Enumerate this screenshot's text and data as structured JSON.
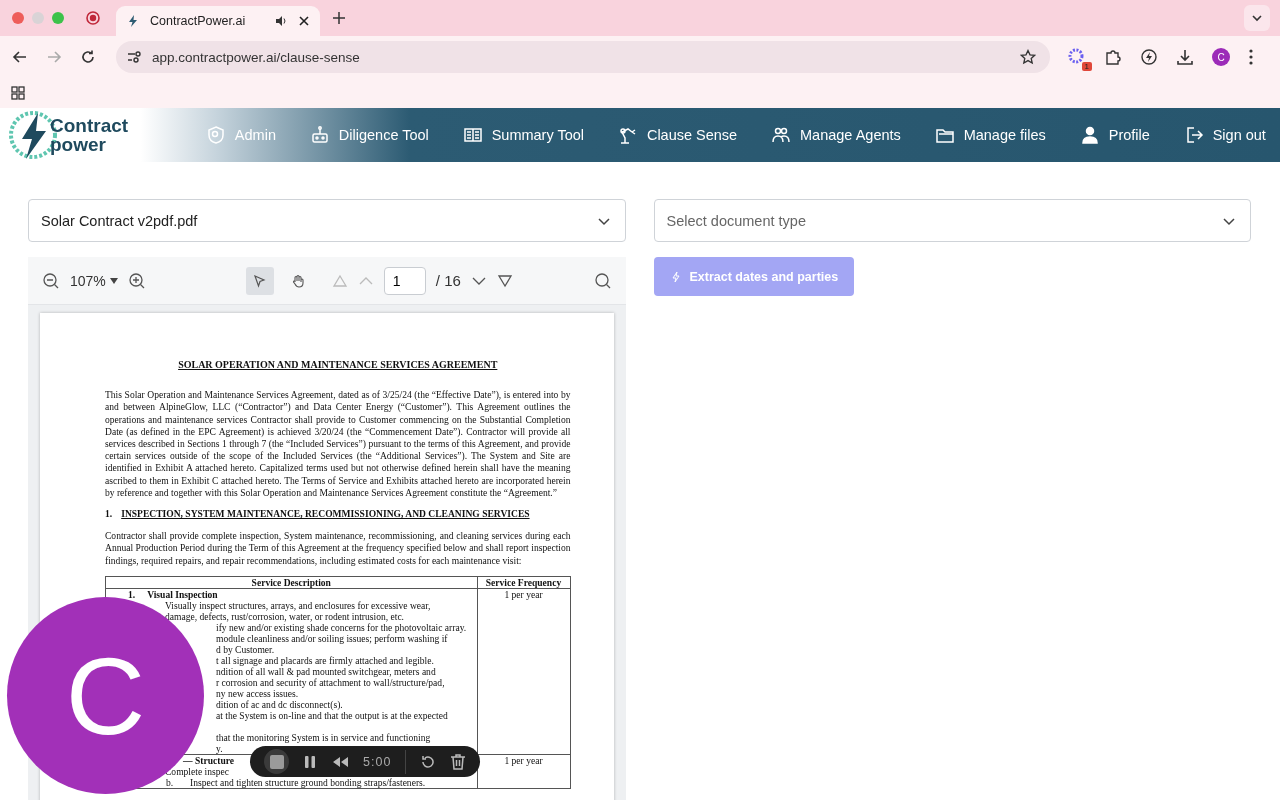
{
  "browser": {
    "tab_title": "ContractPower.ai",
    "url": "app.contractpower.ai/clause-sense",
    "extension_badge": "1",
    "profile_initial": "C"
  },
  "nav": {
    "logo": [
      "Contract",
      "power"
    ],
    "items": [
      {
        "label": "Admin"
      },
      {
        "label": "Diligence Tool"
      },
      {
        "label": "Summary Tool"
      },
      {
        "label": "Clause Sense"
      },
      {
        "label": "Manage Agents"
      },
      {
        "label": "Manage files"
      },
      {
        "label": "Profile"
      },
      {
        "label": "Sign out"
      }
    ]
  },
  "file_select": {
    "value": "Solar Contract v2pdf.pdf"
  },
  "type_select": {
    "placeholder": "Select document type"
  },
  "viewer": {
    "zoom": "107%",
    "page": "1",
    "pages": "/ 16"
  },
  "extract_button": {
    "label": "Extract dates and parties",
    "disabled": true
  },
  "document": {
    "title": "SOLAR OPERATION AND MAINTENANCE SERVICES AGREEMENT",
    "paragraph": "This Solar Operation and Maintenance Services Agreement, dated as of 3/25/24 (the “Effective Date”), is entered into by and between AlpineGlow, LLC (“Contractor”) and Data Center Energy (“Customer”). This Agreement outlines the operations and maintenance services Contractor shall provide to Customer commencing on the Substantial Completion Date (as defined in the EPC Agreement) is achieved 3/20/24 (the “Commencement Date”).  Contractor will provide all services described in Sections 1 through 7 (the “Included Services”) pursuant to the terms of this Agreement, and provide certain services outside of the scope of the Included Services (the “Additional Services”). The System and Site are identified in Exhibit A attached hereto.  Capitalized terms used but not otherwise defined herein shall have the meaning ascribed to them in Exhibit C attached hereto.  The Terms of Service and Exhibits attached hereto are incorporated herein by reference and together with this Solar Operation and Maintenance Services Agreement constitute the “Agreement.”",
    "section_number": "1.",
    "section_title": "INSPECTION, SYSTEM MAINTENANCE, RECOMMISSIONING, AND CLEANING SERVICES",
    "intro": "Contractor shall provide complete inspection, System maintenance, recommissioning, and cleaning services during each Annual Production Period during the Term of this Agreement at the frequency specified below and shall report inspection findings, required repairs, and repair recommendations, including estimated costs for each maintenance visit:",
    "table": {
      "columns": [
        "Service Description",
        "Service Frequency"
      ],
      "rows": [
        {
          "number": "1.",
          "heading": "Visual Inspection",
          "frequency": "1 per year",
          "lines": [
            {
              "kind": "full",
              "text": "Visually inspect structures, arrays, and enclosures for excessive wear,"
            },
            {
              "kind": "full",
              "text": "damage, defects, rust/corrosion, water, or rodent intrusion, etc."
            },
            {
              "kind": "cut",
              "text": "ify new and/or existing shade concerns for the photovoltaic array."
            },
            {
              "kind": "cut",
              "text": "module cleanliness and/or soiling issues; perform washing if"
            },
            {
              "kind": "cut",
              "text": "d by Customer."
            },
            {
              "kind": "cut",
              "text": "t all signage and placards are firmly attached and legible."
            },
            {
              "kind": "cut",
              "text": "ndition of all wall & pad mounted switchgear, meters and"
            },
            {
              "kind": "cut",
              "text": "r corrosion and security of attachment to wall/structure/pad,"
            },
            {
              "kind": "cut",
              "text": "ny new access issues."
            },
            {
              "kind": "cut",
              "text": "dition of ac and dc disconnect(s)."
            },
            {
              "kind": "cut",
              "text": "at the System is on-line and that the output is at the expected"
            },
            {
              "kind": "gap"
            },
            {
              "kind": "cut",
              "text": "that the monitoring System is in service and functioning"
            },
            {
              "kind": "cut",
              "text": "y."
            }
          ]
        },
        {
          "heading": "— Structure",
          "frequency": "1 per year",
          "lines": [
            {
              "kind": "full",
              "text": "Complete inspec"
            },
            {
              "kind": "full",
              "marker": "b.",
              "text": "Inspect and tighten structure ground bonding straps/fasteners."
            }
          ]
        }
      ]
    }
  },
  "webcam": {
    "initial": "C"
  },
  "recorder": {
    "time": "5:00"
  }
}
